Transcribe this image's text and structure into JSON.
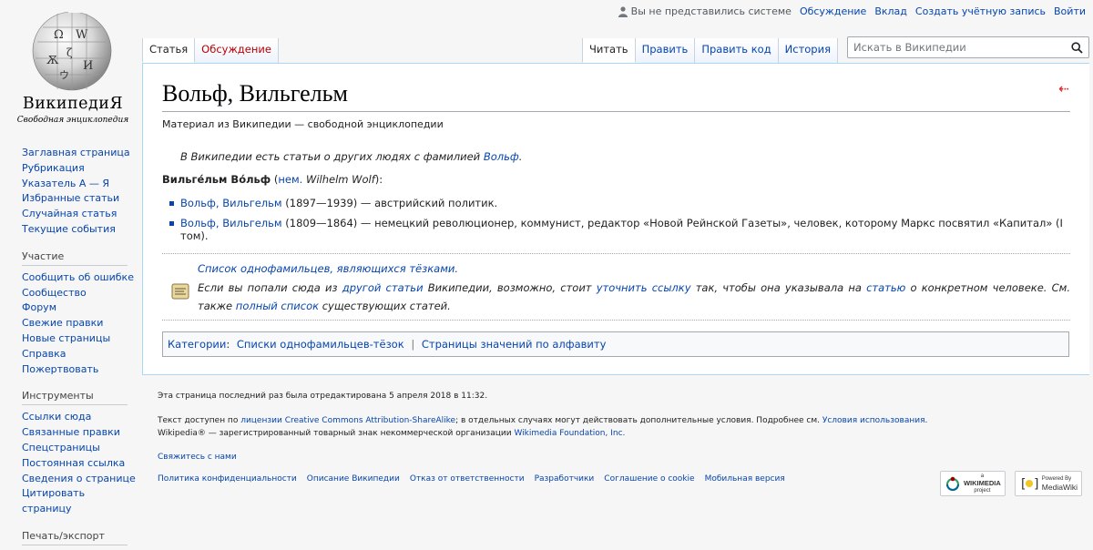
{
  "personal": {
    "anon": "Вы не представились системе",
    "talk": "Обсуждение",
    "contributions": "Вклад",
    "create": "Создать учётную запись",
    "login": "Войти"
  },
  "logo": {
    "wordmark": "ВикипедиЯ",
    "tagline": "Свободная энциклопедия"
  },
  "sidebar": {
    "main": [
      "Заглавная страница",
      "Рубрикация",
      "Указатель А — Я",
      "Избранные статьи",
      "Случайная статья",
      "Текущие события"
    ],
    "participation_head": "Участие",
    "participation": [
      "Сообщить об ошибке",
      "Сообщество",
      "Форум",
      "Свежие правки",
      "Новые страницы",
      "Справка",
      "Пожертвовать"
    ],
    "tools_head": "Инструменты",
    "tools": [
      "Ссылки сюда",
      "Связанные правки",
      "Спецстраницы",
      "Постоянная ссылка",
      "Сведения о странице",
      "Цитировать страницу"
    ],
    "print_head": "Печать/экспорт"
  },
  "tabs": {
    "article": "Статья",
    "discussion": "Обсуждение",
    "read": "Читать",
    "edit": "Править",
    "edit_source": "Править код",
    "history": "История"
  },
  "search": {
    "placeholder": "Искать в Википедии"
  },
  "article": {
    "title": "Вольф, Вильгельм",
    "sitesub": "Материал из Википедии — свободной энциклопедии",
    "hatnote_pre": "В Википедии есть статьи о других людях с фамилией",
    "hatnote_link": "Вольф",
    "lead_bold": "Вильге́льм Во́льф",
    "lead_lang": "нем.",
    "lead_orig": "Wilhelm Wolf",
    "people": [
      {
        "link": "Вольф, Вильгельм",
        "text": "(1897—1939) — австрийский политик."
      },
      {
        "link": "Вольф, Вильгельм",
        "text": "(1809—1864) — немецкий революционер, коммунист, редактор «Новой Рейнской Газеты», человек, которому Маркс посвятил «Капитал» (I том)."
      }
    ],
    "dis_title": "Список однофамильцев, являющихся тёзками.",
    "dis_1": "Если вы попали сюда из",
    "dis_link1": "другой статьи",
    "dis_2": "Википедии, возможно, стоит",
    "dis_link2": "уточнить ссылку",
    "dis_3": "так, чтобы она указывала на",
    "dis_link3": "статью",
    "dis_4": "о конкретном человеке.",
    "dis_5": "См. также",
    "dis_link4": "полный список",
    "dis_6": "существующих статей.",
    "categories_label": "Категории",
    "categories": [
      "Списки однофамильцев-тёзок",
      "Страницы значений по алфавиту"
    ]
  },
  "footer": {
    "lastmod": "Эта страница последний раз была отредактирована 5 апреля 2018 в 11:32.",
    "license_pre": "Текст доступен по",
    "license_link": "лицензии Creative Commons Attribution-ShareAlike",
    "license_post": "; в отдельных случаях могут действовать дополнительные условия. Подробнее см.",
    "terms_link": "Условия использования",
    "trademark_pre": "Wikipedia® — зарегистрированный товарный знак некоммерческой организации",
    "trademark_link": "Wikimedia Foundation, Inc.",
    "contact": "Свяжитесь с нами",
    "places": [
      "Политика конфиденциальности",
      "Описание Википедии",
      "Отказ от ответственности",
      "Разработчики",
      "Соглашение о cookie",
      "Мобильная версия"
    ],
    "badge_wm_top": "a",
    "badge_wm": "WIKIMEDIA",
    "badge_wm_sub": "project",
    "badge_mw_top": "Powered By",
    "badge_mw": "MediaWiki"
  }
}
